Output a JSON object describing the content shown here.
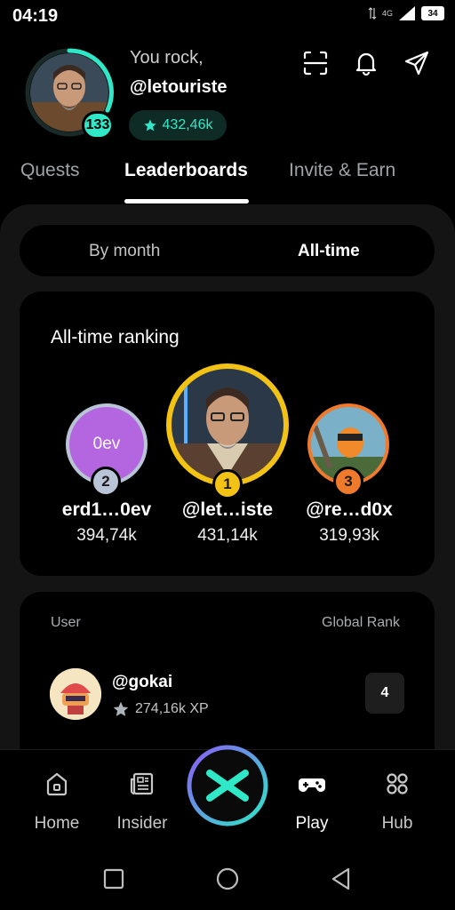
{
  "status": {
    "time": "04:19",
    "network": "4G",
    "battery": "34"
  },
  "header": {
    "greeting": "You rock,",
    "username": "@letouriste",
    "level": "133",
    "xp": "432,46k"
  },
  "tabs": [
    {
      "label": "Quests",
      "active": false
    },
    {
      "label": "Leaderboards",
      "active": true
    },
    {
      "label": "Invite & Earn",
      "active": false
    }
  ],
  "period": {
    "options": [
      "By month",
      "All-time"
    ],
    "selected": "All-time"
  },
  "ranking": {
    "title": "All-time ranking",
    "podium": [
      {
        "rank": "2",
        "name": "erd1…0ev",
        "score": "394,74k",
        "avatar_text": "0ev"
      },
      {
        "rank": "1",
        "name": "@let…iste",
        "score": "431,14k"
      },
      {
        "rank": "3",
        "name": "@re…d0x",
        "score": "319,93k"
      }
    ]
  },
  "list": {
    "col_user": "User",
    "col_rank": "Global Rank",
    "rows": [
      {
        "name": "@gokai",
        "xp": "274,16k XP",
        "rank": "4"
      }
    ]
  },
  "bottom_nav": [
    {
      "label": "Home",
      "icon": "home-icon"
    },
    {
      "label": "Insider",
      "icon": "news-icon"
    },
    {
      "label": "Play",
      "icon": "gamepad-icon"
    },
    {
      "label": "Hub",
      "icon": "grid-icon"
    }
  ],
  "colors": {
    "accent": "#2ee8c8",
    "gold": "#f2c315",
    "silver": "#b9c4d6",
    "bronze": "#f07a2c",
    "purple": "#b366e0"
  }
}
